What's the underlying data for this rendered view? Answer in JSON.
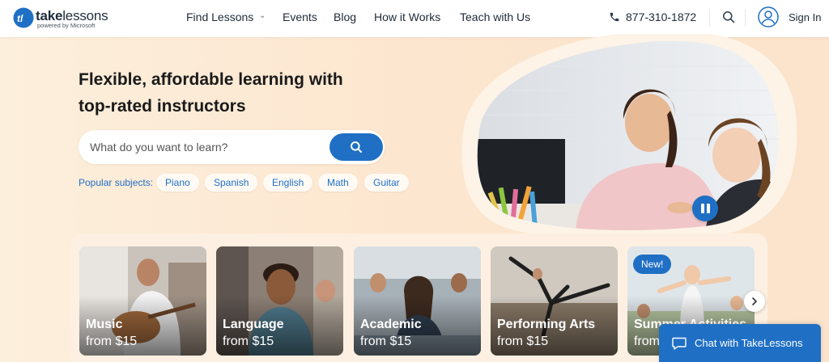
{
  "brand": {
    "name_bold": "take",
    "name_rest": "lessons",
    "tagline": "powered by Microsoft",
    "color": "#1f6fc5"
  },
  "nav": {
    "items": [
      {
        "label": "Find Lessons"
      },
      {
        "label": "Events"
      },
      {
        "label": "Blog"
      },
      {
        "label": "How it Works"
      },
      {
        "label": "Teach with Us"
      }
    ],
    "phone": "877-310-1872",
    "sign_in": "Sign In"
  },
  "hero": {
    "title_line1": "Flexible, affordable learning with",
    "title_line2": "top-rated instructors",
    "search_placeholder": "What do you want to learn?",
    "popular_label": "Popular subjects:",
    "subjects": [
      "Piano",
      "Spanish",
      "English",
      "Math",
      "Guitar"
    ]
  },
  "categories": [
    {
      "title": "Music",
      "price": "from $15"
    },
    {
      "title": "Language",
      "price": "from $15"
    },
    {
      "title": "Academic",
      "price": "from $15"
    },
    {
      "title": "Performing Arts",
      "price": "from $15"
    },
    {
      "title": "Summer Activities",
      "price": "from $15",
      "badge": "New!"
    }
  ],
  "chat": {
    "label": "Chat with TakeLessons"
  },
  "icons": {
    "logo": "takelessons-logo-icon",
    "phone": "phone-icon",
    "search": "search-icon",
    "account": "user-account-icon",
    "pause": "pause-icon",
    "next": "chevron-right-icon",
    "chat": "chat-bubble-icon"
  }
}
